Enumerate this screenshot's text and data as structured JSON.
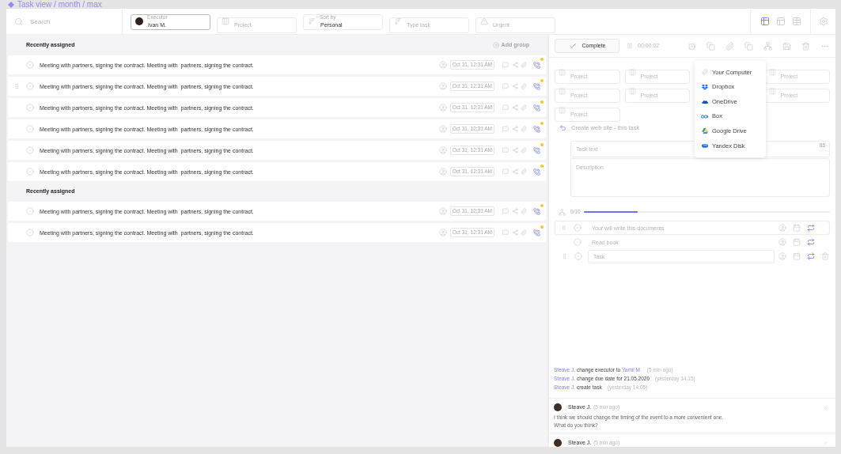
{
  "breadcrumb": "Task view / month / max",
  "toolbar": {
    "search": {
      "placeholder": "Search"
    },
    "filters": [
      {
        "kind": "executor",
        "focused": true,
        "label": "Executor",
        "value": "Ivan M."
      },
      {
        "kind": "project",
        "focused": false,
        "placeholder": "Project"
      },
      {
        "kind": "sort",
        "focused": false,
        "label": "Sort by",
        "value": "Personal"
      },
      {
        "kind": "type",
        "focused": false,
        "placeholder": "Type task"
      },
      {
        "kind": "urgent",
        "focused": false,
        "placeholder": "Urgent"
      }
    ],
    "views": [
      {
        "kind": "board",
        "selected": true
      },
      {
        "kind": "split",
        "selected": false
      },
      {
        "kind": "table",
        "selected": false
      }
    ]
  },
  "task_list": {
    "add_group": "Add group",
    "groups": [
      {
        "title": "Recently assigned",
        "tasks": [
          {
            "text": "Meeting with partners, signing the contract. Meeting with  partners, signing the contract.",
            "date": "Oct 31, 12:31 AM",
            "hovered": false,
            "unread": true
          },
          {
            "text": "Meeting with partners, signing the contract. Meeting with  partners, signing the contract.",
            "date": "Oct 31, 12:31 AM",
            "hovered": true,
            "unread": true
          },
          {
            "text": "Meeting with partners, signing the contract. Meeting with  partners, signing the contract.",
            "date": "Oct 31, 12:31 AM",
            "hovered": false,
            "unread": true
          },
          {
            "text": "Meeting with partners, signing the contract. Meeting with  partners, signing the contract.",
            "date": "Oct 31, 12:31 AM",
            "hovered": false,
            "unread": true
          },
          {
            "text": "Meeting with partners, signing the contract. Meeting with  partners, signing the contract.",
            "date": "Oct 31, 12:31 AM",
            "hovered": false,
            "unread": true
          },
          {
            "text": "Meeting with partners, signing the contract. Meeting with  partners, signing the contract.",
            "date": "Oct 31, 12:31 AM",
            "hovered": false,
            "unread": true
          }
        ]
      },
      {
        "title": "Recently assigned",
        "tasks": [
          {
            "text": "Meeting with partners, signing the contract. Meeting with  partners, signing the contract.",
            "date": "Oct 31, 12:31 AM",
            "hovered": false,
            "unread": true
          },
          {
            "text": "Meeting with partners, signing the contract. Meeting with  partners, signing the contract.",
            "date": "Oct 31, 12:31 AM",
            "hovered": false,
            "unread": true
          }
        ]
      }
    ]
  },
  "detail": {
    "complete": "Complete",
    "timer": "00:00:02",
    "project_fields": [
      {
        "placeholder": "Project"
      },
      {
        "placeholder": "Project"
      },
      {
        "placeholder": "Project"
      },
      {
        "placeholder": "Project"
      },
      {
        "placeholder": "Project"
      },
      {
        "placeholder": "Project"
      },
      {
        "placeholder": "Project"
      }
    ],
    "upload_menu": [
      {
        "kind": "computer",
        "label": "Your Computer"
      },
      {
        "kind": "dropbox",
        "label": "Dropbox"
      },
      {
        "kind": "onedrive",
        "label": "OneDrive"
      },
      {
        "kind": "box",
        "label": "Box"
      },
      {
        "kind": "gdrive",
        "label": "Google Drive"
      },
      {
        "kind": "yandex",
        "label": "Yandex Disk"
      }
    ],
    "parent_task": "Create web site - this task",
    "task_text": {
      "placeholder": "Task text",
      "counter": "86"
    },
    "description": {
      "placeholder": "Description"
    },
    "subtasks": {
      "count": "0/10",
      "level": 0.22,
      "items": [
        {
          "kind": "item",
          "text": "Your will write this documents",
          "hovered": true
        },
        {
          "kind": "item",
          "text": "Read book",
          "hovered": false
        },
        {
          "kind": "new",
          "placeholder": "Task",
          "hovered": true
        }
      ]
    },
    "activity": [
      {
        "user": "Steave J.",
        "action": "change executor to",
        "target": "Yamil M.",
        "time": "(5 min ago)"
      },
      {
        "user": "Steave J.",
        "action": "change due date for 21.05.2020",
        "time": "(yesterday 14:15)"
      },
      {
        "user": "Steave J.",
        "action": "create task",
        "time": "(yesterday 14:05)"
      }
    ],
    "comments": [
      {
        "author": "Steave J.",
        "time": "(5 min ago)",
        "text": "I think we should change the timing of the event to a more convenient one.\nWhat do you think?"
      },
      {
        "author": "Steave J.",
        "time": "(5 min ago)"
      }
    ]
  }
}
